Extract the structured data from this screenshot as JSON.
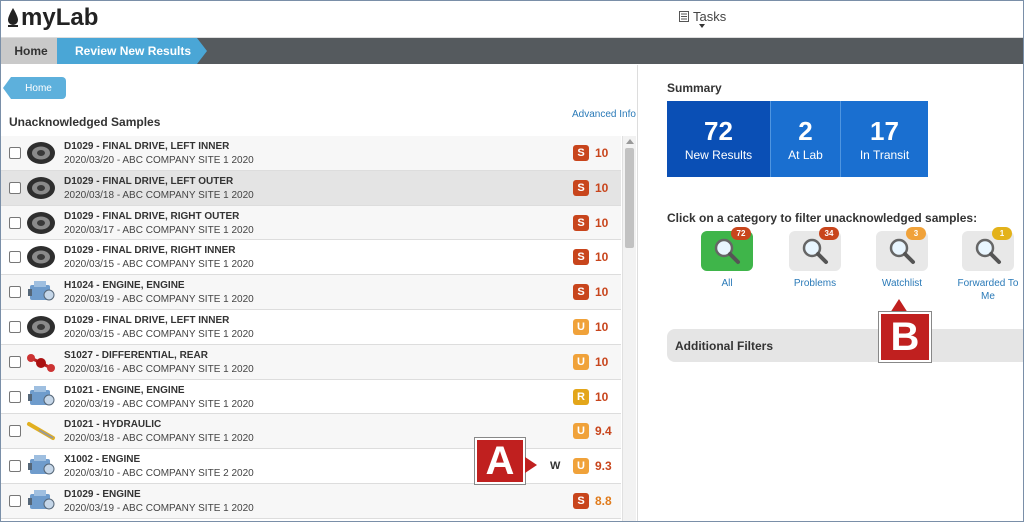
{
  "app": {
    "logo_text": "myLab"
  },
  "header": {
    "tasks_label": "Tasks"
  },
  "breadcrumb": {
    "home": "Home",
    "current": "Review New Results"
  },
  "left": {
    "home_button": "Home",
    "advanced_info": "Advanced Info",
    "list_title": "Unacknowledged Samples",
    "rows": [
      {
        "title": "D1029 - FINAL DRIVE, LEFT INNER",
        "sub": "2020/03/20 - ABC COMPANY SITE 1 2020",
        "severity": "S",
        "score": "10",
        "icon": "tire-icon"
      },
      {
        "title": "D1029 - FINAL DRIVE, LEFT OUTER",
        "sub": "2020/03/18 - ABC COMPANY SITE 1 2020",
        "severity": "S",
        "score": "10",
        "icon": "tire-icon"
      },
      {
        "title": "D1029 - FINAL DRIVE, RIGHT OUTER",
        "sub": "2020/03/17 - ABC COMPANY SITE 1 2020",
        "severity": "S",
        "score": "10",
        "icon": "tire-icon"
      },
      {
        "title": "D1029 - FINAL DRIVE, RIGHT INNER",
        "sub": "2020/03/15 - ABC COMPANY SITE 1 2020",
        "severity": "S",
        "score": "10",
        "icon": "tire-icon"
      },
      {
        "title": "H1024 - ENGINE, ENGINE",
        "sub": "2020/03/19 - ABC COMPANY SITE 1 2020",
        "severity": "S",
        "score": "10",
        "icon": "engine-icon"
      },
      {
        "title": "D1029 - FINAL DRIVE, LEFT INNER",
        "sub": "2020/03/15 - ABC COMPANY SITE 1 2020",
        "severity": "U",
        "score": "10",
        "icon": "tire-icon"
      },
      {
        "title": "S1027 - DIFFERENTIAL, REAR",
        "sub": "2020/03/16 - ABC COMPANY SITE 1 2020",
        "severity": "U",
        "score": "10",
        "icon": "axle-icon"
      },
      {
        "title": "D1021 - ENGINE, ENGINE",
        "sub": "2020/03/19 - ABC COMPANY SITE 1 2020",
        "severity": "R",
        "score": "10",
        "icon": "engine-icon"
      },
      {
        "title": "D1021 - HYDRAULIC",
        "sub": "2020/03/18 - ABC COMPANY SITE 1 2020",
        "severity": "U",
        "score": "9.4",
        "icon": "hydraulic-icon"
      },
      {
        "title": "X1002 - ENGINE",
        "sub": "2020/03/10 - ABC COMPANY SITE 2 2020",
        "severity": "U",
        "score": "9.3",
        "icon": "engine-icon",
        "flag": "W"
      },
      {
        "title": "D1029 - ENGINE",
        "sub": "2020/03/19 - ABC COMPANY SITE 1 2020",
        "severity": "S",
        "score": "8.8",
        "icon": "engine-icon"
      }
    ]
  },
  "summary": {
    "title": "Summary",
    "tiles": [
      {
        "value": "72",
        "label": "New Results"
      },
      {
        "value": "2",
        "label": "At Lab"
      },
      {
        "value": "17",
        "label": "In Transit"
      }
    ],
    "filter_hint": "Click on a category to filter unacknowledged samples:",
    "categories": [
      {
        "label": "All",
        "count": "72",
        "badge_color": "#c8451c"
      },
      {
        "label": "Problems",
        "count": "34",
        "badge_color": "#c8451c"
      },
      {
        "label": "Watchlist",
        "count": "3",
        "badge_color": "#f0a23a"
      },
      {
        "label": "Forwarded To Me",
        "count": "1",
        "badge_color": "#e3b21a"
      }
    ],
    "additional_filters": "Additional Filters"
  },
  "callouts": {
    "a": "A",
    "b": "B"
  },
  "colors": {
    "accent": "#4aa6d6",
    "tile_blue": "#1a6fd0",
    "severe": "#c8451c",
    "urgent": "#f0a23a"
  }
}
